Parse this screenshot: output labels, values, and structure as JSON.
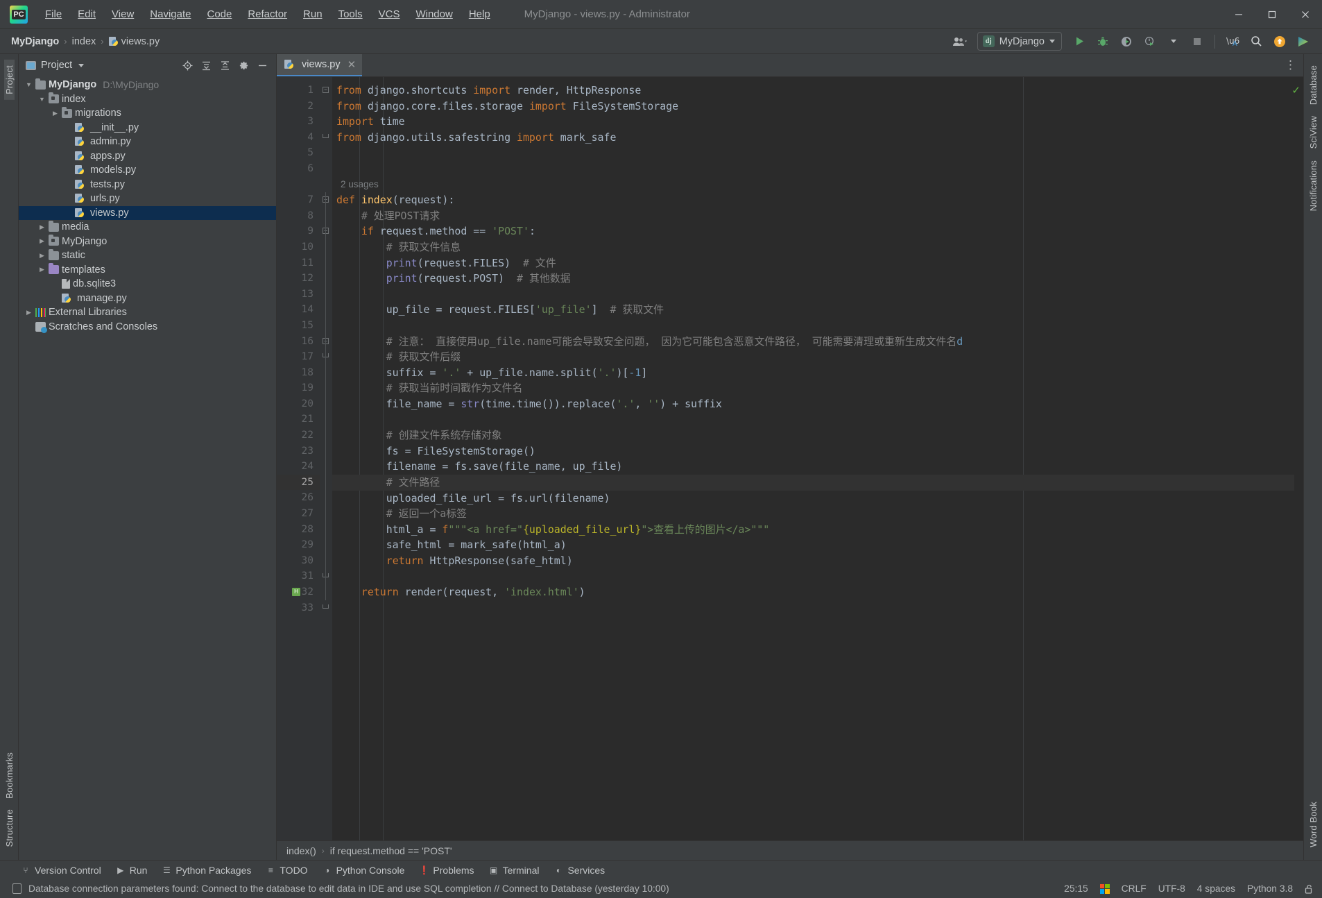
{
  "window": {
    "title": "MyDjango - views.py - Administrator",
    "logo_text": "PC",
    "minimize": "─",
    "maximize": "☐",
    "close": "✕"
  },
  "menubar": [
    {
      "label": "File"
    },
    {
      "label": "Edit"
    },
    {
      "label": "View"
    },
    {
      "label": "Navigate"
    },
    {
      "label": "Code"
    },
    {
      "label": "Refactor"
    },
    {
      "label": "Run"
    },
    {
      "label": "Tools"
    },
    {
      "label": "VCS"
    },
    {
      "label": "Window"
    },
    {
      "label": "Help"
    }
  ],
  "navbar": {
    "crumbs": [
      {
        "label": "MyDjango"
      },
      {
        "label": "index"
      },
      {
        "label": "views.py"
      }
    ],
    "separator": "›",
    "run_config": {
      "name": "MyDjango",
      "badge": "dj"
    },
    "icons": [
      "user-group-icon",
      "run-icon",
      "debug-icon",
      "coverage-icon",
      "profile-icon",
      "stop-icon",
      "translate-icon",
      "search-everywhere-icon",
      "updates-icon",
      "ide-assistant-icon"
    ]
  },
  "left_rail": {
    "items": [
      {
        "label": "Project",
        "active": true
      },
      {
        "label": "Bookmarks",
        "active": false
      },
      {
        "label": "Structure",
        "active": false
      }
    ]
  },
  "right_rail": {
    "items": [
      {
        "label": "Database"
      },
      {
        "label": "SciView"
      },
      {
        "label": "Notifications"
      },
      {
        "label": "Word Book"
      }
    ]
  },
  "project_panel": {
    "title": "Project",
    "actions": [
      "select-opened-file-icon",
      "expand-all-icon",
      "collapse-all-icon",
      "settings-gear-icon",
      "hide-icon"
    ],
    "tree": [
      {
        "depth": 0,
        "twist": "down",
        "icon": "folder",
        "label": "MyDjango",
        "bold": true,
        "path": "D:\\MyDjango"
      },
      {
        "depth": 1,
        "twist": "down",
        "icon": "folder-src",
        "label": "index"
      },
      {
        "depth": 2,
        "twist": "right",
        "icon": "folder-src",
        "label": "migrations"
      },
      {
        "depth": 3,
        "twist": "none",
        "icon": "python",
        "label": "__init__.py"
      },
      {
        "depth": 3,
        "twist": "none",
        "icon": "python",
        "label": "admin.py"
      },
      {
        "depth": 3,
        "twist": "none",
        "icon": "python",
        "label": "apps.py"
      },
      {
        "depth": 3,
        "twist": "none",
        "icon": "python",
        "label": "models.py"
      },
      {
        "depth": 3,
        "twist": "none",
        "icon": "python",
        "label": "tests.py"
      },
      {
        "depth": 3,
        "twist": "none",
        "icon": "python",
        "label": "urls.py"
      },
      {
        "depth": 3,
        "twist": "none",
        "icon": "python",
        "label": "views.py",
        "selected": true
      },
      {
        "depth": 1,
        "twist": "right",
        "icon": "folder",
        "label": "media"
      },
      {
        "depth": 1,
        "twist": "right",
        "icon": "folder-src",
        "label": "MyDjango"
      },
      {
        "depth": 1,
        "twist": "right",
        "icon": "folder",
        "label": "static"
      },
      {
        "depth": 1,
        "twist": "right",
        "icon": "folder-tpl",
        "label": "templates"
      },
      {
        "depth": 2,
        "twist": "none",
        "icon": "db",
        "label": "db.sqlite3"
      },
      {
        "depth": 2,
        "twist": "none",
        "icon": "python",
        "label": "manage.py"
      },
      {
        "depth": 0,
        "twist": "right",
        "icon": "libs",
        "label": "External Libraries"
      },
      {
        "depth": 0,
        "twist": "none",
        "icon": "scratches",
        "label": "Scratches and Consoles"
      }
    ]
  },
  "editor": {
    "tab": {
      "label": "views.py",
      "close": "✕",
      "icon": "python-file-icon"
    },
    "more_icon": "⋮",
    "inspection_status": "✓",
    "usage_hint": {
      "line_after": 6,
      "text": "2 usages"
    },
    "current_line": 25,
    "lines": [
      {
        "n": 1,
        "tokens": [
          [
            "kw",
            "from"
          ],
          [
            "txt",
            " django.shortcuts "
          ],
          [
            "kw",
            "import"
          ],
          [
            "txt",
            " render, HttpResponse"
          ]
        ]
      },
      {
        "n": 2,
        "tokens": [
          [
            "kw",
            "from"
          ],
          [
            "txt",
            " django.core.files.storage "
          ],
          [
            "kw",
            "import"
          ],
          [
            "txt",
            " FileSystemStorage"
          ]
        ]
      },
      {
        "n": 3,
        "tokens": [
          [
            "kw",
            "import"
          ],
          [
            "txt",
            " time"
          ]
        ]
      },
      {
        "n": 4,
        "tokens": [
          [
            "kw",
            "from"
          ],
          [
            "txt",
            " django.utils.safestring "
          ],
          [
            "kw",
            "import"
          ],
          [
            "txt",
            " mark_safe"
          ]
        ]
      },
      {
        "n": 5,
        "tokens": []
      },
      {
        "n": 6,
        "tokens": []
      },
      {
        "n": 7,
        "tokens": [
          [
            "kw",
            "def "
          ],
          [
            "fn",
            "index"
          ],
          [
            "txt",
            "(request):"
          ]
        ]
      },
      {
        "n": 8,
        "tokens": [
          [
            "txt",
            "    "
          ],
          [
            "cmt",
            "# 处理POST请求"
          ]
        ]
      },
      {
        "n": 9,
        "tokens": [
          [
            "txt",
            "    "
          ],
          [
            "kw",
            "if"
          ],
          [
            "txt",
            " request.method == "
          ],
          [
            "str",
            "'POST'"
          ],
          [
            "txt",
            ":"
          ]
        ]
      },
      {
        "n": 10,
        "tokens": [
          [
            "txt",
            "        "
          ],
          [
            "cmt",
            "# 获取文件信息"
          ]
        ]
      },
      {
        "n": 11,
        "tokens": [
          [
            "txt",
            "        "
          ],
          [
            "bi",
            "print"
          ],
          [
            "txt",
            "(request.FILES)  "
          ],
          [
            "cmt",
            "# 文件"
          ]
        ]
      },
      {
        "n": 12,
        "tokens": [
          [
            "txt",
            "        "
          ],
          [
            "bi",
            "print"
          ],
          [
            "txt",
            "(request.POST)  "
          ],
          [
            "cmt",
            "# 其他数据"
          ]
        ]
      },
      {
        "n": 13,
        "tokens": []
      },
      {
        "n": 14,
        "tokens": [
          [
            "txt",
            "        up_file = request.FILES["
          ],
          [
            "str",
            "'up_file'"
          ],
          [
            "txt",
            "]  "
          ],
          [
            "cmt",
            "# 获取文件"
          ]
        ]
      },
      {
        "n": 15,
        "tokens": []
      },
      {
        "n": 16,
        "tokens": [
          [
            "txt",
            "        "
          ],
          [
            "cmt",
            "# 注意： 直接使用up_file.name可能会导致安全问题， 因为它可能包含恶意文件路径， 可能需要清理或重新生成文件名"
          ],
          [
            "num",
            "d"
          ]
        ]
      },
      {
        "n": 17,
        "tokens": [
          [
            "txt",
            "        "
          ],
          [
            "cmt",
            "# 获取文件后缀"
          ]
        ]
      },
      {
        "n": 18,
        "tokens": [
          [
            "txt",
            "        suffix = "
          ],
          [
            "str",
            "'.'"
          ],
          [
            "txt",
            " + up_file.name.split("
          ],
          [
            "str",
            "'.'"
          ],
          [
            "txt",
            ")["
          ],
          [
            "num",
            "-1"
          ],
          [
            "txt",
            "]"
          ]
        ]
      },
      {
        "n": 19,
        "tokens": [
          [
            "txt",
            "        "
          ],
          [
            "cmt",
            "# 获取当前时间戳作为文件名"
          ]
        ]
      },
      {
        "n": 20,
        "tokens": [
          [
            "txt",
            "        file_name = "
          ],
          [
            "bi",
            "str"
          ],
          [
            "txt",
            "(time.time()).replace("
          ],
          [
            "str",
            "'.'"
          ],
          [
            "txt",
            ", "
          ],
          [
            "str",
            "''"
          ],
          [
            "txt",
            ") + suffix"
          ]
        ]
      },
      {
        "n": 21,
        "tokens": []
      },
      {
        "n": 22,
        "tokens": [
          [
            "txt",
            "        "
          ],
          [
            "cmt",
            "# 创建文件系统存储对象"
          ]
        ]
      },
      {
        "n": 23,
        "tokens": [
          [
            "txt",
            "        fs = FileSystemStorage()"
          ]
        ]
      },
      {
        "n": 24,
        "tokens": [
          [
            "txt",
            "        filename = fs.save(file_name, up_file)"
          ]
        ]
      },
      {
        "n": 25,
        "tokens": [
          [
            "txt",
            "        "
          ],
          [
            "cmt",
            "# 文件路径"
          ]
        ]
      },
      {
        "n": 26,
        "tokens": [
          [
            "txt",
            "        uploaded_file_url = fs.url(filename)"
          ]
        ]
      },
      {
        "n": 27,
        "tokens": [
          [
            "txt",
            "        "
          ],
          [
            "cmt",
            "# 返回一个a标签"
          ]
        ]
      },
      {
        "n": 28,
        "tokens": [
          [
            "txt",
            "        html_a = "
          ],
          [
            "kw",
            "f"
          ],
          [
            "str",
            "\"\"\"<a href=\""
          ],
          [
            "decor",
            "{uploaded_file_url}"
          ],
          [
            "str",
            "\">查看上传的图片</a>\"\"\""
          ]
        ]
      },
      {
        "n": 29,
        "tokens": [
          [
            "txt",
            "        safe_html = mark_safe(html_a)"
          ]
        ]
      },
      {
        "n": 30,
        "tokens": [
          [
            "txt",
            "        "
          ],
          [
            "kw",
            "return"
          ],
          [
            "txt",
            " HttpResponse(safe_html)"
          ]
        ]
      },
      {
        "n": 31,
        "tokens": []
      },
      {
        "n": 32,
        "tokens": [
          [
            "txt",
            "    "
          ],
          [
            "kw",
            "return"
          ],
          [
            "txt",
            " render(request, "
          ],
          [
            "str",
            "'index.html'"
          ],
          [
            "txt",
            ")"
          ]
        ]
      },
      {
        "n": 33,
        "tokens": []
      }
    ],
    "breadcrumb": {
      "items": [
        "index()",
        "if request.method == 'POST'"
      ],
      "separator": "›"
    }
  },
  "tool_windows": [
    {
      "label": "Version Control",
      "icon": "branch-icon"
    },
    {
      "label": "Run",
      "icon": "run-icon"
    },
    {
      "label": "Python Packages",
      "icon": "packages-icon"
    },
    {
      "label": "TODO",
      "icon": "todo-icon"
    },
    {
      "label": "Python Console",
      "icon": "python-console-icon"
    },
    {
      "label": "Problems",
      "icon": "problems-icon"
    },
    {
      "label": "Terminal",
      "icon": "terminal-icon"
    },
    {
      "label": "Services",
      "icon": "services-icon"
    }
  ],
  "statusbar": {
    "message": "Database connection parameters found: Connect to the database to edit data in IDE and use SQL completion // Connect to Database (yesterday 10:00)",
    "caret_position": "25:15",
    "line_separator": "CRLF",
    "encoding": "UTF-8",
    "indent": "4 spaces",
    "interpreter": "Python 3.8",
    "lock_icon": "🔓"
  },
  "colors": {
    "chrome": "#3c3f41",
    "editor_bg": "#2b2b2b",
    "gutter_bg": "#313335",
    "selection": "#0d2d4f",
    "accent": "#4a88c7",
    "ok_green": "#62b543"
  }
}
